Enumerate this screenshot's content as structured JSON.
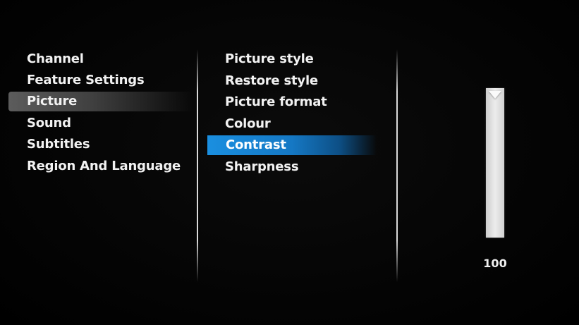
{
  "menu": {
    "items": [
      {
        "label": "Channel"
      },
      {
        "label": "Feature Settings"
      },
      {
        "label": "Picture",
        "active": true
      },
      {
        "label": "Sound"
      },
      {
        "label": "Subtitles"
      },
      {
        "label": "Region And Language"
      }
    ]
  },
  "submenu": {
    "items": [
      {
        "label": "Picture style"
      },
      {
        "label": "Restore style"
      },
      {
        "label": "Picture format"
      },
      {
        "label": "Colour"
      },
      {
        "label": "Contrast",
        "selected": true
      },
      {
        "label": "Sharpness"
      }
    ]
  },
  "slider": {
    "value": "100",
    "level": 100,
    "max": 100
  },
  "colors": {
    "background": "#000000",
    "highlight_active": "#4a4a4a",
    "highlight_selected": "#1a8fe0",
    "text": "#f2f2f2"
  }
}
